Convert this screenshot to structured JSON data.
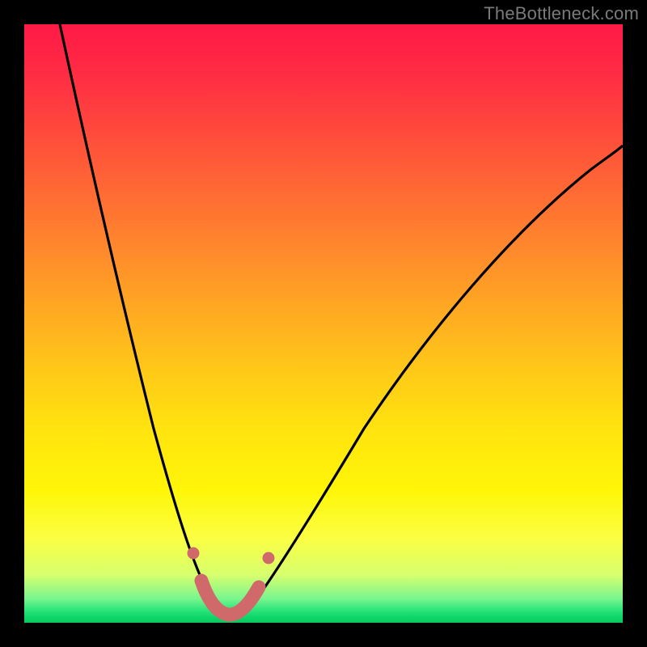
{
  "watermark": "TheBottleneck.com",
  "colors": {
    "frame": "#000000",
    "gradient_top": "#ff1a46",
    "gradient_mid": "#ffe40e",
    "gradient_bottom": "#09c95f",
    "curve_stroke": "#000000",
    "highlight": "#d36a6a"
  },
  "chart_data": {
    "type": "line",
    "title": "",
    "xlabel": "",
    "ylabel": "",
    "xlim": [
      0,
      100
    ],
    "ylim": [
      0,
      100
    ],
    "series": [
      {
        "name": "bottleneck-curve",
        "x": [
          6,
          8,
          10,
          12,
          14,
          16,
          18,
          20,
          22,
          24,
          26,
          28,
          30,
          31,
          32,
          33,
          34,
          35,
          37,
          39,
          42,
          46,
          50,
          55,
          60,
          66,
          72,
          80,
          88,
          96,
          100
        ],
        "y": [
          100,
          92,
          83,
          75,
          67,
          59,
          51,
          44,
          37,
          30,
          23,
          16,
          9,
          5,
          2,
          1,
          1,
          2,
          4,
          7,
          12,
          19,
          26,
          33,
          40,
          47,
          53,
          60,
          66,
          71,
          74
        ]
      }
    ],
    "annotations": [
      {
        "name": "valley-highlight",
        "type": "segment",
        "x0": 29.5,
        "y0": 10,
        "x1": 37.5,
        "y1": 10,
        "note": "pink/salmon thick U-shaped marker near curve minimum"
      }
    ]
  }
}
